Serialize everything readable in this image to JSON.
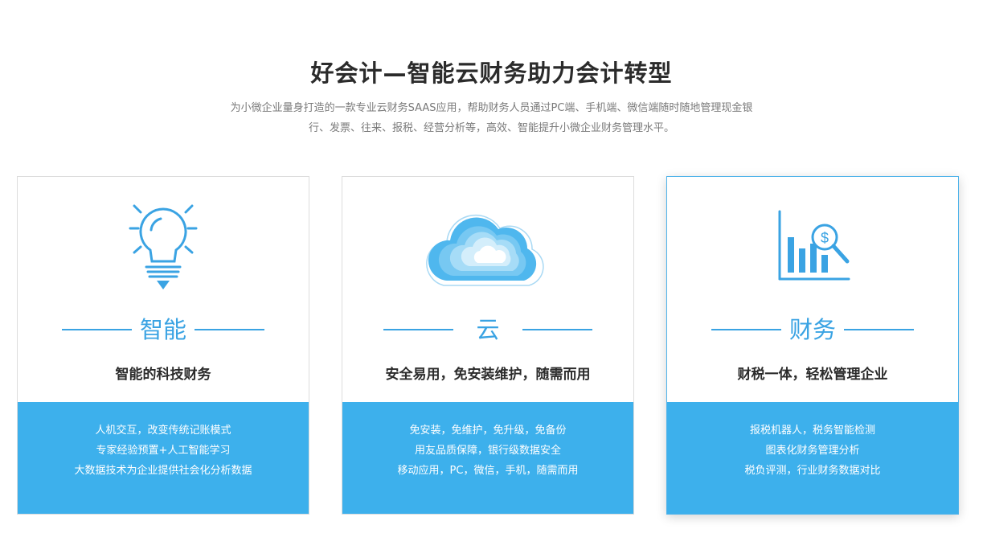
{
  "hero": {
    "title": "好会计—智能云财务助力会计转型",
    "desc_line1": "为小微企业量身打造的一款专业云财务SAAS应用，帮助财务人员通过PC端、手机端、微信端随时随地管理现金银",
    "desc_line2": "行、发票、往来、报税、经营分析等，高效、智能提升小微企业财务管理水平。"
  },
  "colors": {
    "accent": "#3aa3e3",
    "panel": "#3db0ec",
    "border": "#dcdcdc"
  },
  "cards": [
    {
      "icon": "lightbulb-icon",
      "heading": "智能",
      "subtitle": "智能的科技财务",
      "lines": [
        "人机交互，改变传统记账模式",
        "专家经验预置+人工智能学习",
        "大数据技术为企业提供社会化分析数据"
      ]
    },
    {
      "icon": "cloud-icon",
      "heading": "云",
      "subtitle": "安全易用，免安装维护，随需而用",
      "lines": [
        "免安装，免维护，免升级，免备份",
        "用友品质保障，银行级数据安全",
        "移动应用，PC，微信，手机，随需而用"
      ]
    },
    {
      "icon": "finance-chart-icon",
      "heading": "财务",
      "subtitle": "财税一体，轻松管理企业",
      "lines": [
        "报税机器人，税务智能检测",
        "图表化财务管理分析",
        "税负评测，行业财务数据对比"
      ]
    }
  ]
}
